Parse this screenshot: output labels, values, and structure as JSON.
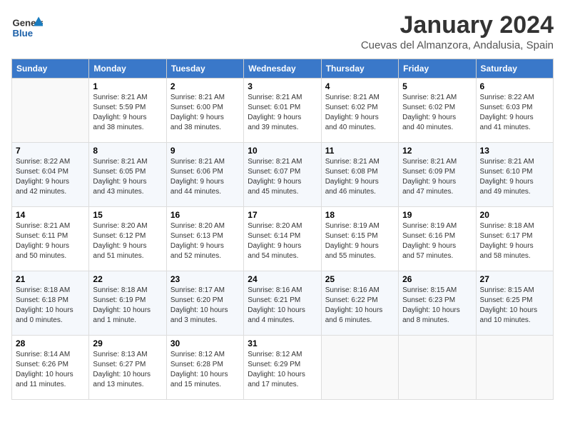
{
  "header": {
    "logo_line1": "General",
    "logo_line2": "Blue",
    "month_title": "January 2024",
    "subtitle": "Cuevas del Almanzora, Andalusia, Spain"
  },
  "days_of_week": [
    "Sunday",
    "Monday",
    "Tuesday",
    "Wednesday",
    "Thursday",
    "Friday",
    "Saturday"
  ],
  "weeks": [
    [
      {
        "day": "",
        "info": ""
      },
      {
        "day": "1",
        "info": "Sunrise: 8:21 AM\nSunset: 5:59 PM\nDaylight: 9 hours\nand 38 minutes."
      },
      {
        "day": "2",
        "info": "Sunrise: 8:21 AM\nSunset: 6:00 PM\nDaylight: 9 hours\nand 38 minutes."
      },
      {
        "day": "3",
        "info": "Sunrise: 8:21 AM\nSunset: 6:01 PM\nDaylight: 9 hours\nand 39 minutes."
      },
      {
        "day": "4",
        "info": "Sunrise: 8:21 AM\nSunset: 6:02 PM\nDaylight: 9 hours\nand 40 minutes."
      },
      {
        "day": "5",
        "info": "Sunrise: 8:21 AM\nSunset: 6:02 PM\nDaylight: 9 hours\nand 40 minutes."
      },
      {
        "day": "6",
        "info": "Sunrise: 8:22 AM\nSunset: 6:03 PM\nDaylight: 9 hours\nand 41 minutes."
      }
    ],
    [
      {
        "day": "7",
        "info": "Sunrise: 8:22 AM\nSunset: 6:04 PM\nDaylight: 9 hours\nand 42 minutes."
      },
      {
        "day": "8",
        "info": "Sunrise: 8:21 AM\nSunset: 6:05 PM\nDaylight: 9 hours\nand 43 minutes."
      },
      {
        "day": "9",
        "info": "Sunrise: 8:21 AM\nSunset: 6:06 PM\nDaylight: 9 hours\nand 44 minutes."
      },
      {
        "day": "10",
        "info": "Sunrise: 8:21 AM\nSunset: 6:07 PM\nDaylight: 9 hours\nand 45 minutes."
      },
      {
        "day": "11",
        "info": "Sunrise: 8:21 AM\nSunset: 6:08 PM\nDaylight: 9 hours\nand 46 minutes."
      },
      {
        "day": "12",
        "info": "Sunrise: 8:21 AM\nSunset: 6:09 PM\nDaylight: 9 hours\nand 47 minutes."
      },
      {
        "day": "13",
        "info": "Sunrise: 8:21 AM\nSunset: 6:10 PM\nDaylight: 9 hours\nand 49 minutes."
      }
    ],
    [
      {
        "day": "14",
        "info": "Sunrise: 8:21 AM\nSunset: 6:11 PM\nDaylight: 9 hours\nand 50 minutes."
      },
      {
        "day": "15",
        "info": "Sunrise: 8:20 AM\nSunset: 6:12 PM\nDaylight: 9 hours\nand 51 minutes."
      },
      {
        "day": "16",
        "info": "Sunrise: 8:20 AM\nSunset: 6:13 PM\nDaylight: 9 hours\nand 52 minutes."
      },
      {
        "day": "17",
        "info": "Sunrise: 8:20 AM\nSunset: 6:14 PM\nDaylight: 9 hours\nand 54 minutes."
      },
      {
        "day": "18",
        "info": "Sunrise: 8:19 AM\nSunset: 6:15 PM\nDaylight: 9 hours\nand 55 minutes."
      },
      {
        "day": "19",
        "info": "Sunrise: 8:19 AM\nSunset: 6:16 PM\nDaylight: 9 hours\nand 57 minutes."
      },
      {
        "day": "20",
        "info": "Sunrise: 8:18 AM\nSunset: 6:17 PM\nDaylight: 9 hours\nand 58 minutes."
      }
    ],
    [
      {
        "day": "21",
        "info": "Sunrise: 8:18 AM\nSunset: 6:18 PM\nDaylight: 10 hours\nand 0 minutes."
      },
      {
        "day": "22",
        "info": "Sunrise: 8:18 AM\nSunset: 6:19 PM\nDaylight: 10 hours\nand 1 minute."
      },
      {
        "day": "23",
        "info": "Sunrise: 8:17 AM\nSunset: 6:20 PM\nDaylight: 10 hours\nand 3 minutes."
      },
      {
        "day": "24",
        "info": "Sunrise: 8:16 AM\nSunset: 6:21 PM\nDaylight: 10 hours\nand 4 minutes."
      },
      {
        "day": "25",
        "info": "Sunrise: 8:16 AM\nSunset: 6:22 PM\nDaylight: 10 hours\nand 6 minutes."
      },
      {
        "day": "26",
        "info": "Sunrise: 8:15 AM\nSunset: 6:23 PM\nDaylight: 10 hours\nand 8 minutes."
      },
      {
        "day": "27",
        "info": "Sunrise: 8:15 AM\nSunset: 6:25 PM\nDaylight: 10 hours\nand 10 minutes."
      }
    ],
    [
      {
        "day": "28",
        "info": "Sunrise: 8:14 AM\nSunset: 6:26 PM\nDaylight: 10 hours\nand 11 minutes."
      },
      {
        "day": "29",
        "info": "Sunrise: 8:13 AM\nSunset: 6:27 PM\nDaylight: 10 hours\nand 13 minutes."
      },
      {
        "day": "30",
        "info": "Sunrise: 8:12 AM\nSunset: 6:28 PM\nDaylight: 10 hours\nand 15 minutes."
      },
      {
        "day": "31",
        "info": "Sunrise: 8:12 AM\nSunset: 6:29 PM\nDaylight: 10 hours\nand 17 minutes."
      },
      {
        "day": "",
        "info": ""
      },
      {
        "day": "",
        "info": ""
      },
      {
        "day": "",
        "info": ""
      }
    ]
  ]
}
